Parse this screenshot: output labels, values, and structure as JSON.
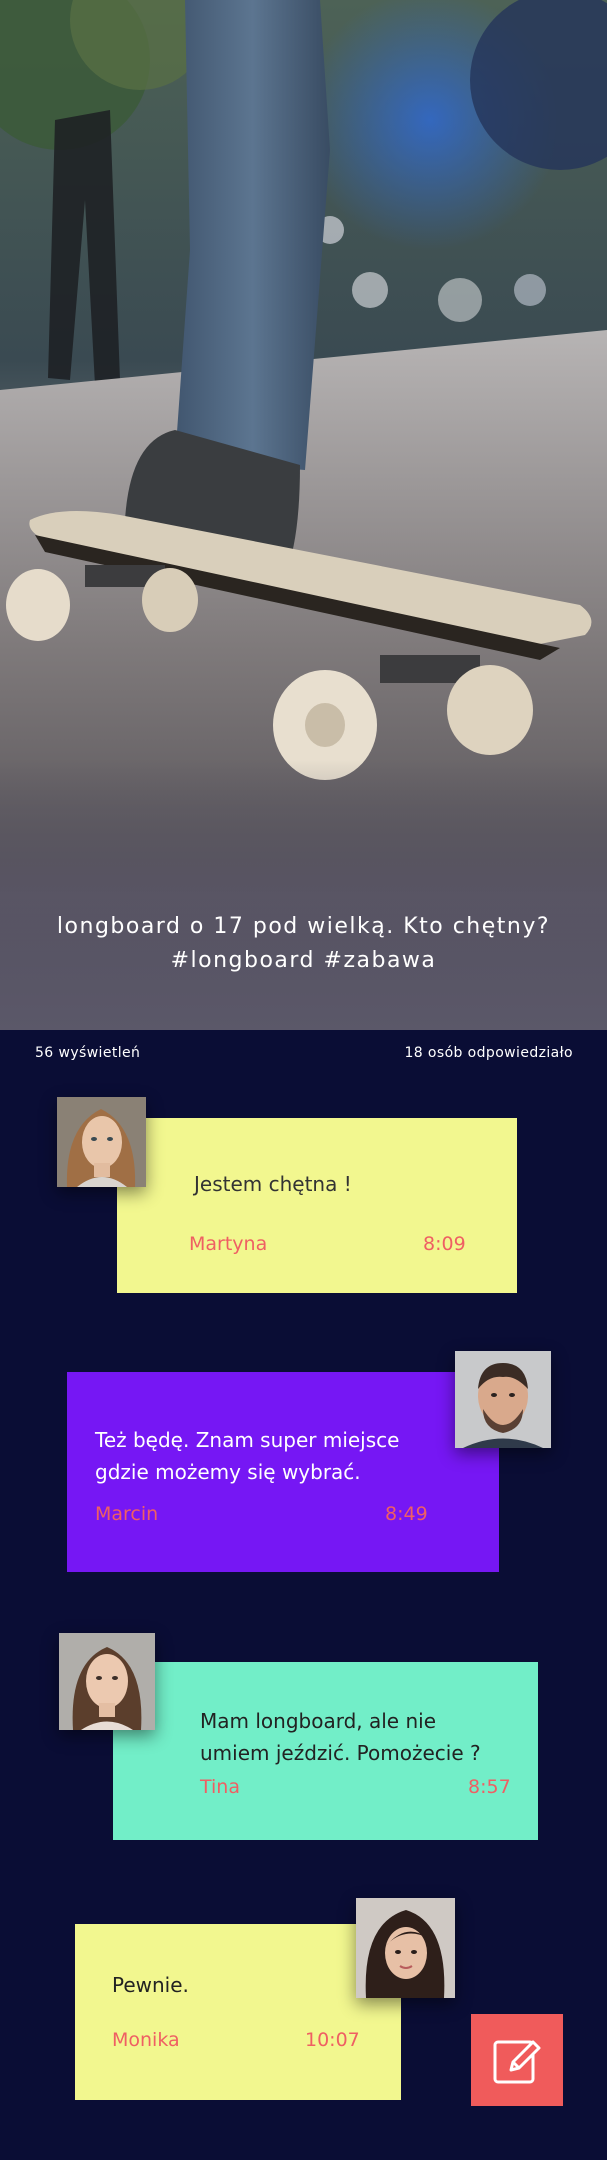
{
  "post": {
    "caption_line1": "longboard o 17 pod wielką. Kto chętny?",
    "caption_line2": "#longboard #zabawa"
  },
  "stats": {
    "views": "56 wyświetleń",
    "responses": "18 osób odpowiedziało"
  },
  "messages": [
    {
      "text": "Jestem chętna !",
      "author": "Martyna",
      "time": "8:09",
      "card_color": "#f2f78f"
    },
    {
      "text_line1": "Też będę. Znam super miejsce",
      "text_line2": "gdzie możemy się wybrać.",
      "author": "Marcin",
      "time": "8:49",
      "card_color": "#7617f4"
    },
    {
      "text_line1": "Mam longboard, ale nie",
      "text_line2": "umiem jeździć. Pomożecie ?",
      "author": "Tina",
      "time": "8:57",
      "card_color": "#72eec8"
    },
    {
      "text": "Pewnie.",
      "author": "Monika",
      "time": "10:07",
      "card_color": "#f2f78f"
    }
  ],
  "actions": {
    "compose_icon": "pencil-edit-icon"
  },
  "colors": {
    "background": "#0a0d35",
    "accent": "#f05b5b",
    "name_time": "#ef5f63"
  }
}
